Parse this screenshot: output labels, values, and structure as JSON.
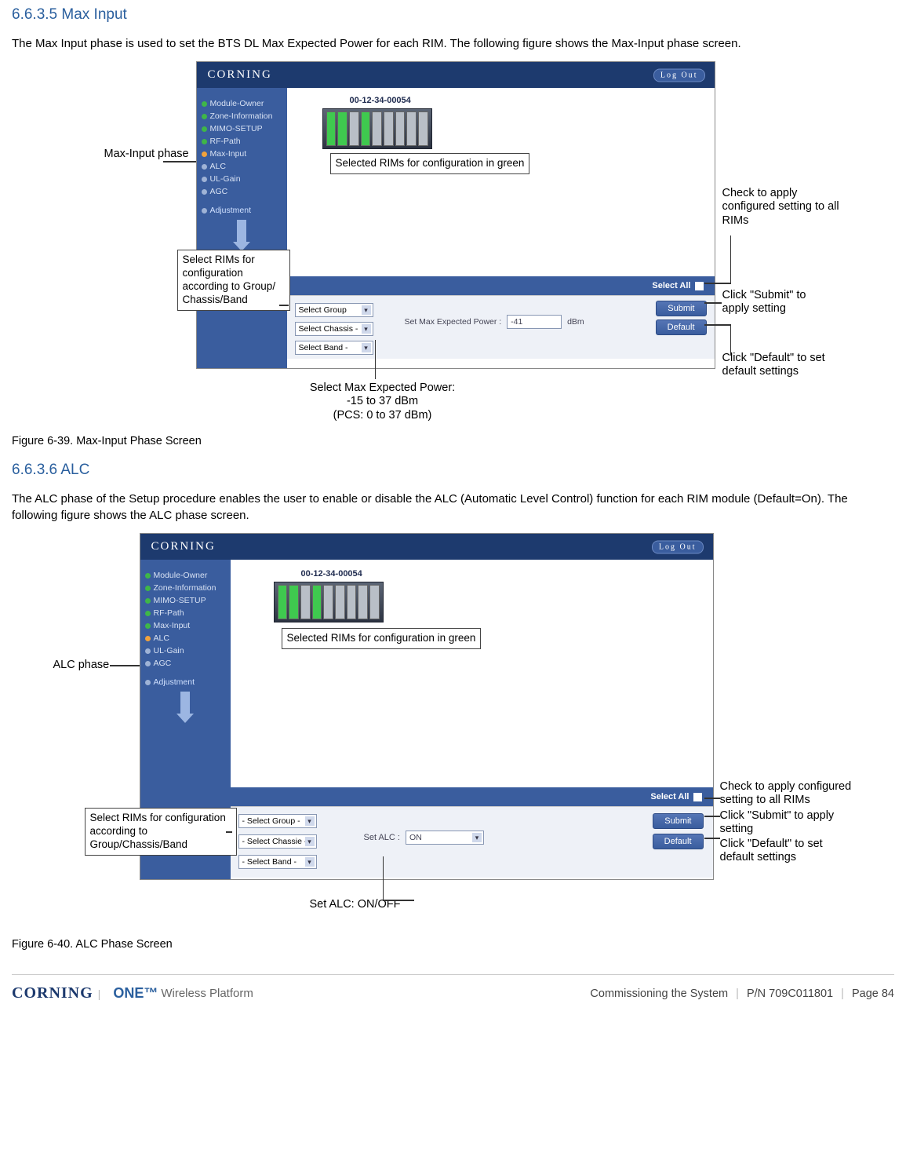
{
  "section1": {
    "heading": "6.6.3.5    Max Input",
    "body": "The Max Input phase is used to set the BTS DL Max Expected Power for each RIM. The following figure shows the Max-Input phase screen.",
    "caption": "Figure 6-39. Max-Input Phase Screen"
  },
  "section2": {
    "heading": "6.6.3.6    ALC",
    "body": "The ALC phase of the Setup procedure enables the user to enable or disable the ALC (Automatic Level Control) function for each RIM module (Default=On). The following figure shows the ALC phase screen.",
    "caption": "Figure 6-40. ALC Phase Screen"
  },
  "ui": {
    "brand": "CORNING",
    "logout": "Log Out",
    "mac": "00-12-34-00054",
    "sidebar": {
      "moduleOwner": "Module-Owner",
      "zoneInfo": "Zone-Information",
      "mimo": "MIMO-SETUP",
      "rfPath": "RF-Path",
      "maxInput": "Max-Input",
      "alc": "ALC",
      "ulGain": "UL-Gain",
      "agc": "AGC",
      "adjustment": "Adjustment"
    },
    "selectedBox": "Selected RIMs for configuration in green",
    "selectAll": "Select All",
    "submit": "Submit",
    "default": "Default",
    "dropdowns": {
      "group": "- Select Group -",
      "chassis": "- Select Chassie -",
      "band": "- Select Band -",
      "groupShort": "Select Group",
      "chassisShort": "Select Chassis -",
      "bandShort": "Select Band -"
    },
    "fig1": {
      "fieldLabel": "Set Max Expected Power :",
      "fieldVal": "-41",
      "fieldUnit": "dBm"
    },
    "fig2": {
      "fieldLabel": "Set ALC :",
      "fieldVal": "ON"
    }
  },
  "annot": {
    "fig1": {
      "maxInputPhase": "Max-Input phase",
      "selRims": "Select RIMs for configuration according to Group/ Chassis/Band",
      "selPower": "Select Max Expected Power:\n-15 to 37 dBm\n(PCS: 0 to 37 dBm)",
      "checkAll": "Check to apply configured setting to all RIMs",
      "clickSubmit": "Click \"Submit\" to apply setting",
      "clickDefault": "Click \"Default\" to set default settings"
    },
    "fig2": {
      "alcPhase": "ALC phase",
      "selRims": "Select RIMs for configuration according to Group/Chassis/Band",
      "setAlc": "Set ALC: ON/OFF",
      "checkAll": "Check to apply configured setting to all RIMs",
      "clickSubmit": "Click \"Submit\" to apply setting",
      "clickDefault": "Click \"Default\" to set default settings"
    }
  },
  "footer": {
    "brand1": "CORNING",
    "brand2": "ONE™",
    "brandsub": "Wireless Platform",
    "crumb": "Commissioning the System",
    "pn": "P/N 709C011801",
    "page": "Page 84"
  }
}
